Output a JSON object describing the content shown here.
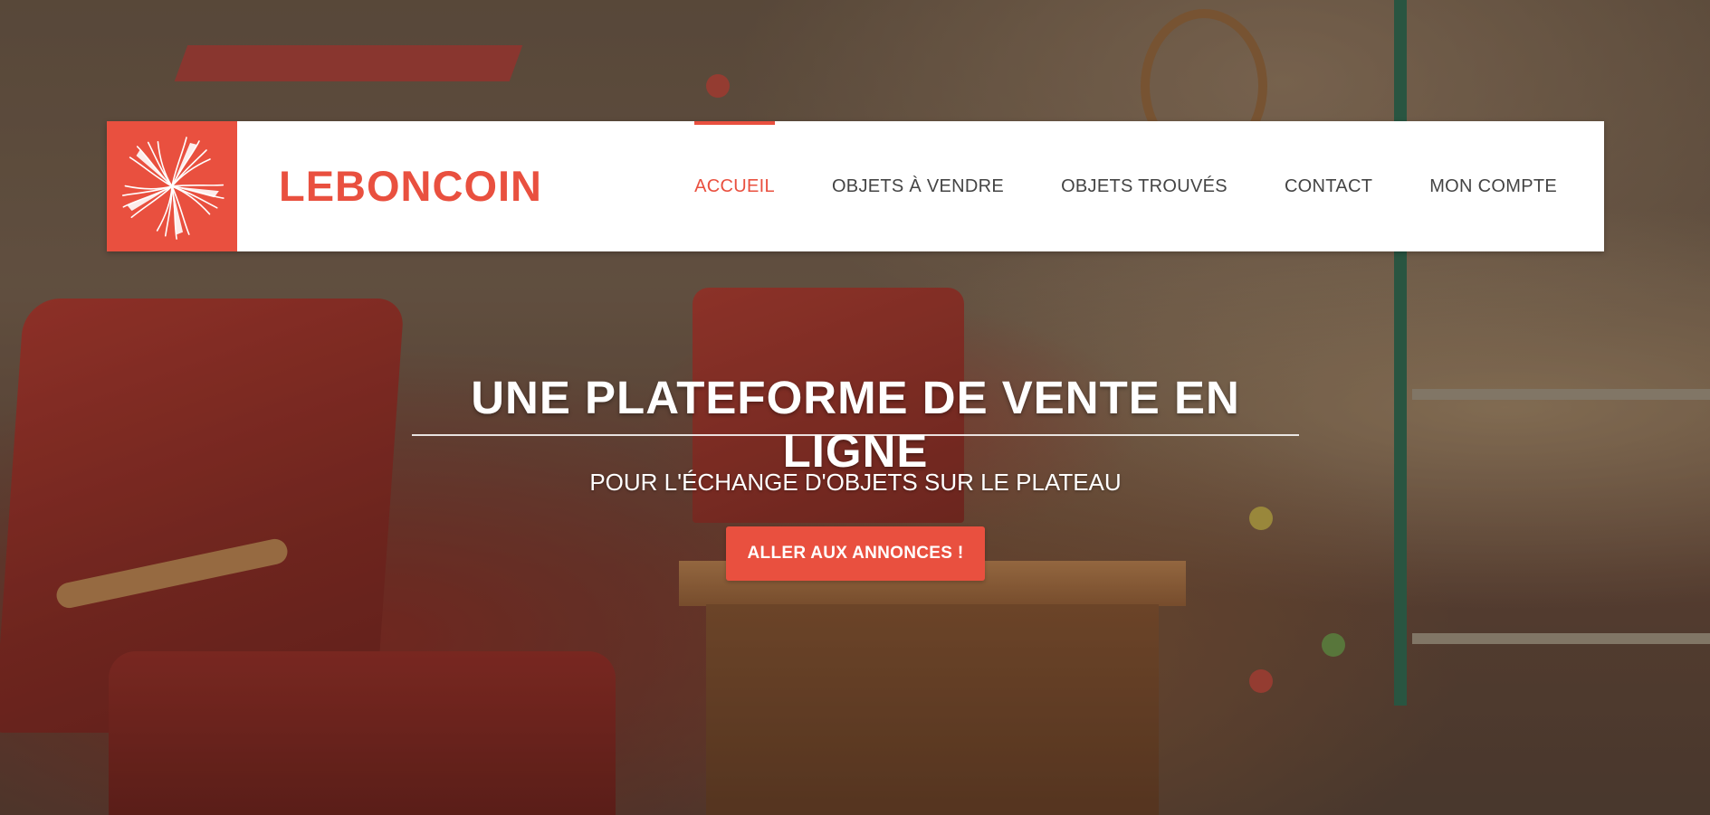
{
  "brand": {
    "name": "LEBONCOIN",
    "logo_icon": "pinwheel-flower-icon",
    "accent_color": "#e9503f"
  },
  "nav": {
    "items": [
      {
        "label": "ACCUEIL",
        "active": true
      },
      {
        "label": "OBJETS À VENDRE",
        "active": false
      },
      {
        "label": "OBJETS TROUVÉS",
        "active": false
      },
      {
        "label": "CONTACT",
        "active": false
      },
      {
        "label": "MON COMPTE",
        "active": false
      }
    ]
  },
  "hero": {
    "headline": "UNE PLATEFORME DE VENTE EN LIGNE",
    "subline": "POUR L'ÉCHANGE D'OBJETS SUR LE PLATEAU",
    "cta_label": "ALLER AUX ANNONCES !"
  }
}
